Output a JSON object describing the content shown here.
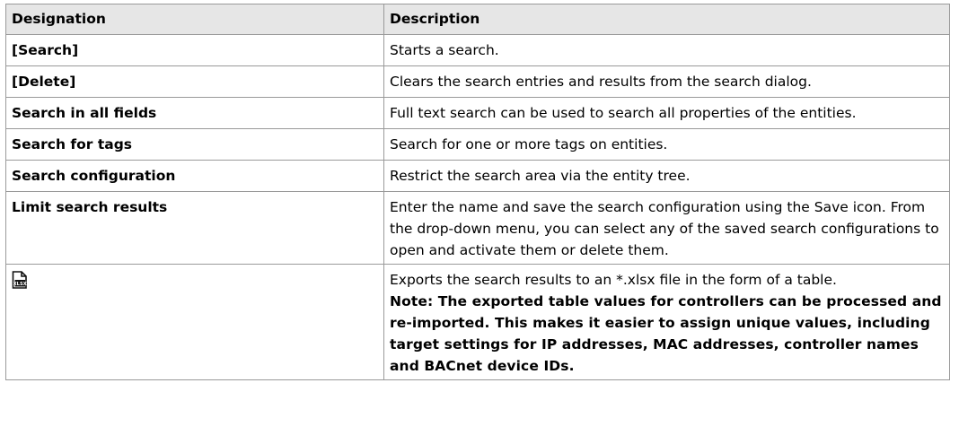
{
  "table": {
    "headers": {
      "designation": "Designation",
      "description": "Description"
    },
    "rows": [
      {
        "designation": "[Search]",
        "description": "Starts a search."
      },
      {
        "designation": "[Delete]",
        "description": "Clears the search entries and results from the search dialog."
      },
      {
        "designation": "Search in all fields",
        "description": "Full text search can be used to search all properties of the entities."
      },
      {
        "designation": "Search for tags",
        "description": "Search for one or more tags on entities."
      },
      {
        "designation": "Search configuration",
        "description": "Restrict the search area via the entity tree."
      },
      {
        "designation": "Limit search results",
        "description": "Enter the name and save the search configuration using the Save icon. From the drop-down menu, you can select any of the saved search configurations to open and activate them or delete them."
      }
    ],
    "export_row": {
      "icon": "xlsx-export-icon",
      "description": "Exports the search results to an *.xlsx file in the form of a table.",
      "note": "Note: The exported table values for controllers can be processed and re-imported. This makes it easier to assign unique values, including target settings for IP addresses, MAC addresses, controller names and BACnet device IDs."
    }
  }
}
